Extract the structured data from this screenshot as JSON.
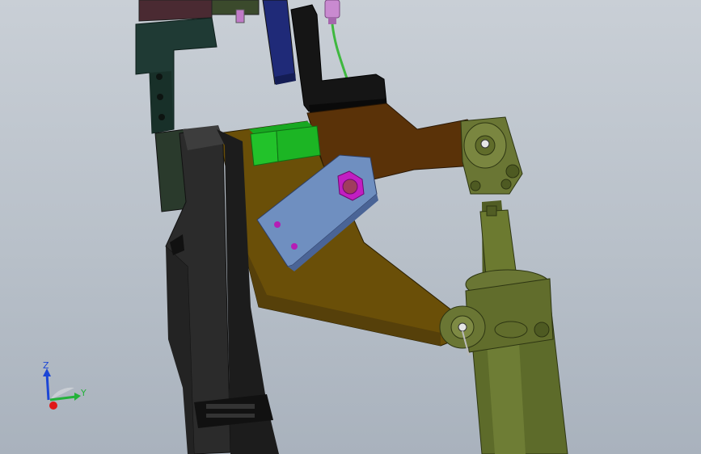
{
  "viewport": {
    "background_top": "#c9cfd6",
    "background_bottom": "#a9b2bd"
  },
  "model": {
    "parts": [
      {
        "id": "upper-dark-plate",
        "color": "#4a2a32"
      },
      {
        "id": "connector-block",
        "color": "#3b4a2c"
      },
      {
        "id": "blue-bar",
        "color": "#1f2a78"
      },
      {
        "id": "dark-green-l-bracket",
        "color": "#1f3a34"
      },
      {
        "id": "black-clamp-arm",
        "color": "#141414"
      },
      {
        "id": "black-base-column",
        "color": "#2b2b2b"
      },
      {
        "id": "brown-arm-upper",
        "color": "#5a3208"
      },
      {
        "id": "olive-arm-lower",
        "color": "#6a4f08"
      },
      {
        "id": "green-switch-block",
        "color": "#22c22a"
      },
      {
        "id": "blue-link-plate",
        "color": "#6f8fc0"
      },
      {
        "id": "magenta-nut",
        "color": "#c21ec2"
      },
      {
        "id": "green-cable",
        "color": "#3fb83f"
      },
      {
        "id": "pink-connector",
        "color": "#c98ad0"
      },
      {
        "id": "cylinder-body",
        "color": "#5d6b2a"
      },
      {
        "id": "cylinder-clevis",
        "color": "#6a7634"
      }
    ]
  },
  "triad": {
    "z_label": "Z",
    "y_label": "Y",
    "z_color": "#1c46d6",
    "y_color": "#23b23a",
    "x_color": "#e01818"
  }
}
